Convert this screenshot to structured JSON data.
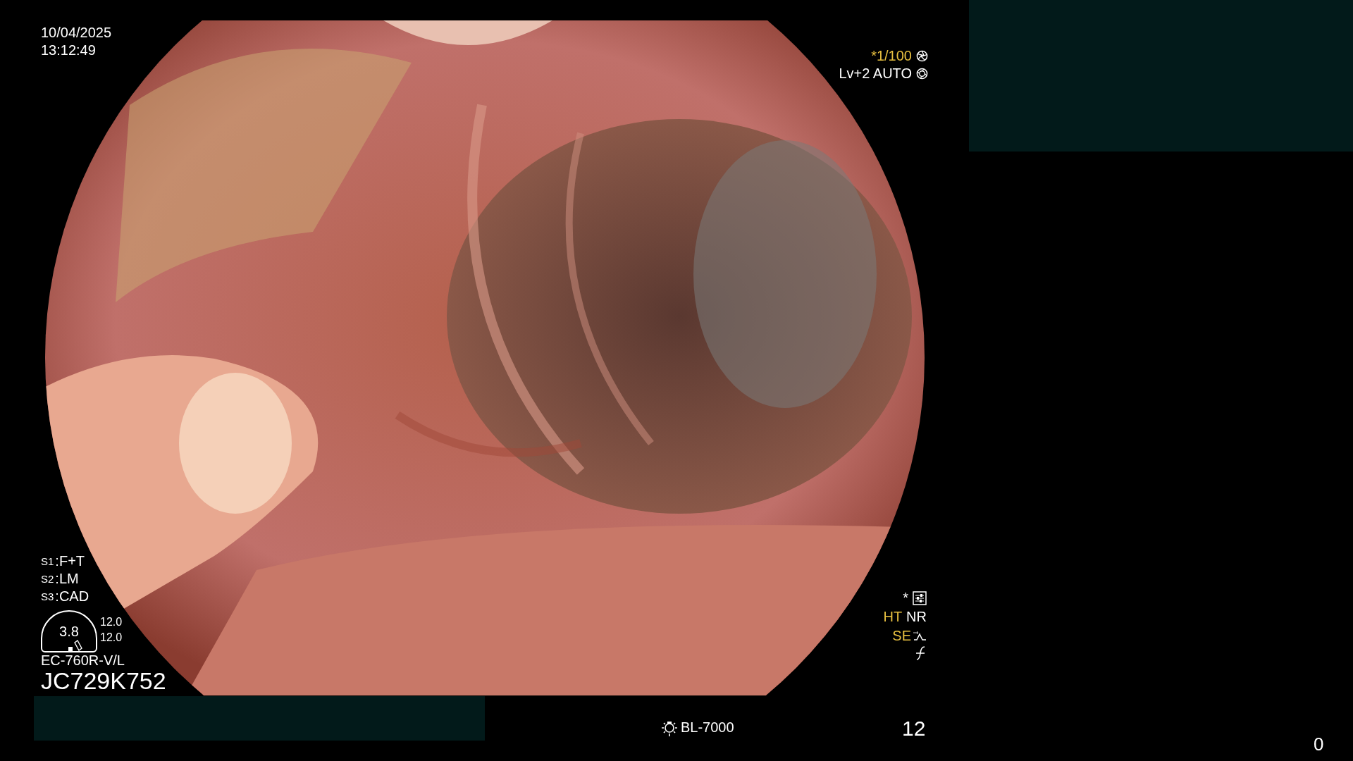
{
  "datetime": {
    "date": "10/04/2025",
    "time": "13:12:49"
  },
  "exposure": {
    "shutter": "*1/100",
    "mode": "Lv+2 AUTO"
  },
  "switches": [
    {
      "label": "S1",
      "value": ":F+T"
    },
    {
      "label": "S2",
      "value": ":LM"
    },
    {
      "label": "S3",
      "value": ":CAD"
    }
  ],
  "zoom_gauge": {
    "value": "3.8",
    "readings": [
      "12.0",
      "12.0"
    ]
  },
  "scope": {
    "model": "EC-760R-V/L",
    "serial": "JC729K752"
  },
  "indicators": {
    "mark": "*",
    "row": [
      {
        "text": "HT",
        "color": "#e8c040"
      },
      {
        "text": "NR",
        "color": "#ffffff"
      }
    ],
    "enhance": {
      "text": "SE",
      "color": "#e8c040"
    }
  },
  "light_source": {
    "model": "BL-7000"
  },
  "counter": "12",
  "monitor_counter": "0"
}
